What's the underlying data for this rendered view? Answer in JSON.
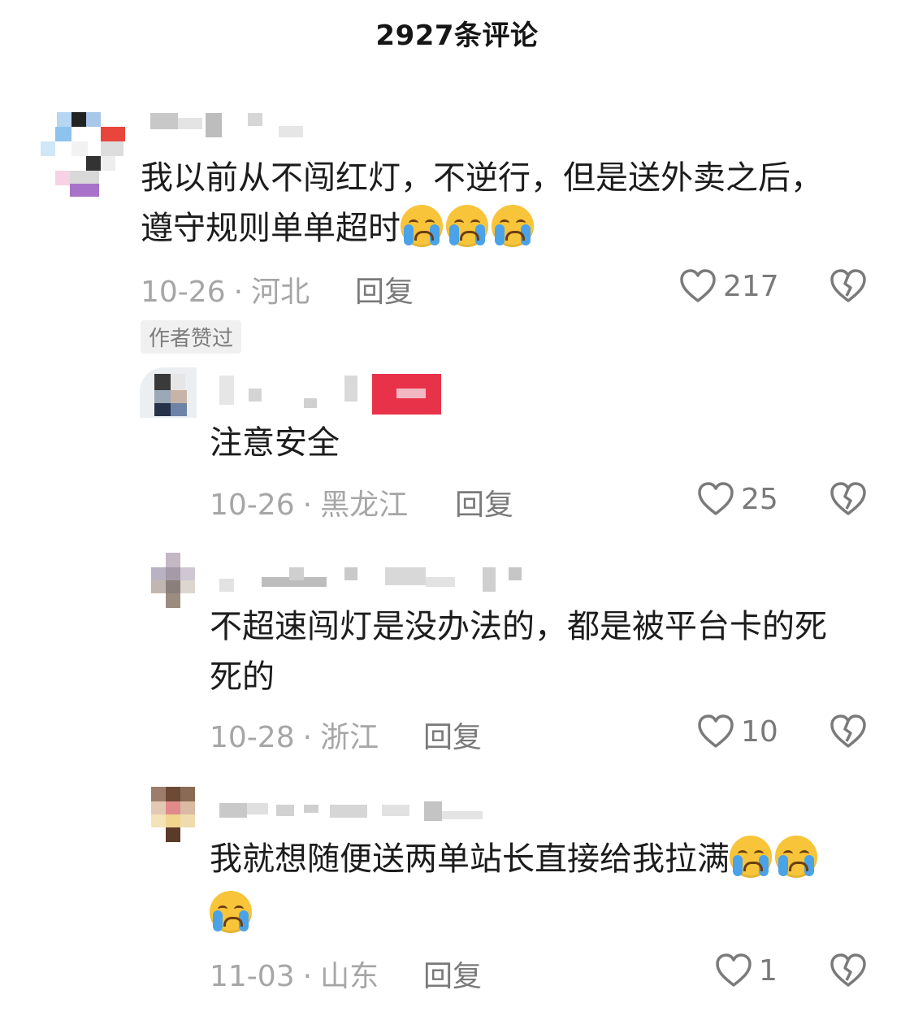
{
  "header": {
    "title": "2927条评论"
  },
  "comments": [
    {
      "text_line1": "我以前从不闯红灯，不逆行，但是送外卖之后，",
      "text_line2": "遵守规则单单超时",
      "emoji": "loudly-crying-face",
      "date": "10-26",
      "location": "河北",
      "reply_label": "回复",
      "likes": "217",
      "badge": "作者赞过"
    },
    {
      "text_line1": "注意安全",
      "date": "10-26",
      "location": "黑龙江",
      "reply_label": "回复",
      "likes": "25"
    },
    {
      "text_line1": "不超速闯灯是没办法的，都是被平台卡的死",
      "text_line2": "死的",
      "date": "10-28",
      "location": "浙江",
      "reply_label": "回复",
      "likes": "10"
    },
    {
      "text_line1": "我就想随便送两单站长直接给我拉满",
      "emoji": "loudly-crying-face",
      "date": "11-03",
      "location": "山东",
      "reply_label": "回复",
      "likes": "1"
    }
  ],
  "colors": {
    "badge_red": "#e8324a",
    "emoji_yellow": "#f8c43a",
    "meta_gray": "#a6a6a6"
  },
  "icons": [
    "heart-icon",
    "broken-heart-icon",
    "loudly-crying-face-emoji"
  ]
}
